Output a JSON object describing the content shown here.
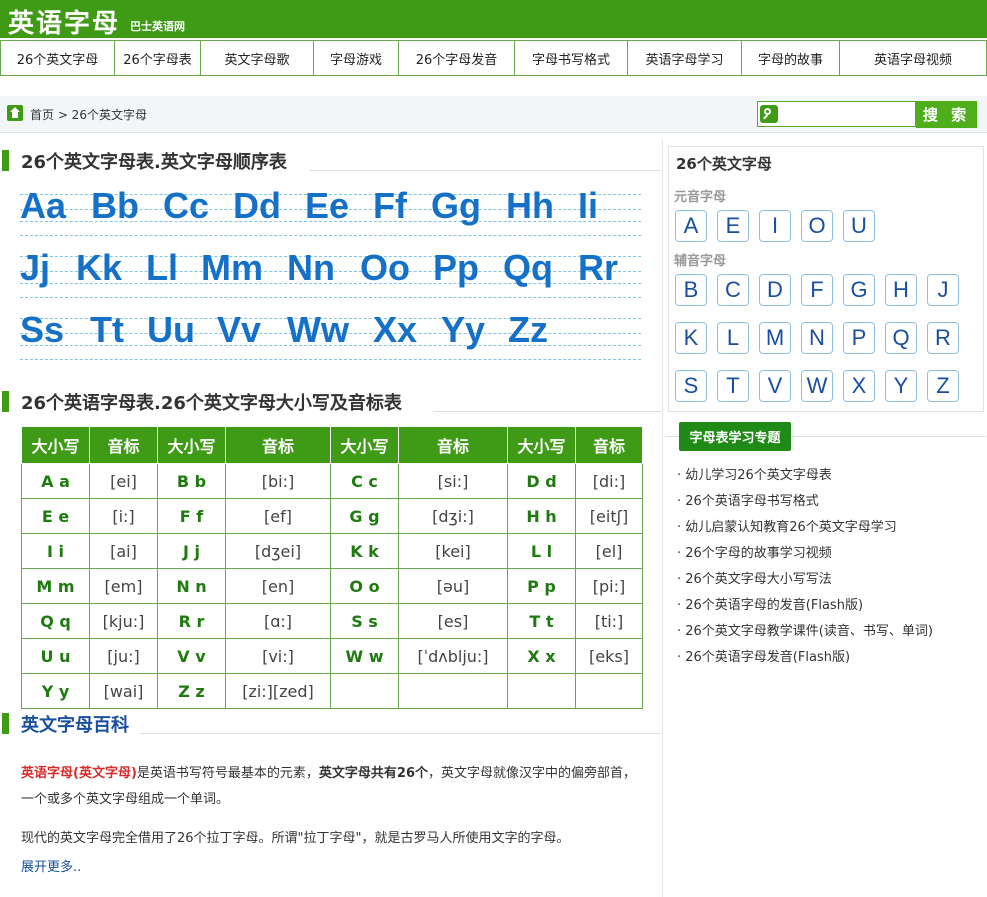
{
  "site": {
    "logo": "英语字母",
    "logo_sub": "巴士英语网"
  },
  "nav": [
    "26个英文字母",
    "26个字母表",
    "英文字母歌",
    "字母游戏",
    "26个字母发音",
    "字母书写格式",
    "英语字母学习",
    "字母的故事",
    "英语字母视频"
  ],
  "breadcrumb": "首页 > 26个英文字母",
  "search": {
    "placeholder": "",
    "button": "搜 索"
  },
  "section1": {
    "title": "26个英文字母表.英文字母顺序表"
  },
  "alphabet_rows": [
    [
      "Aa",
      "Bb",
      "Cc",
      "Dd",
      "Ee",
      "Ff",
      "Gg",
      "Hh",
      "Ii"
    ],
    [
      "Jj",
      "Kk",
      "Ll",
      "Mm",
      "Nn",
      "Oo",
      "Pp",
      "Qq",
      "Rr"
    ],
    [
      "Ss",
      "Tt",
      "Uu",
      "Vv",
      "Ww",
      "Xx",
      "Yy",
      "Zz"
    ]
  ],
  "section2": {
    "title": "26个英语字母表.26个英文字母大小写及音标表"
  },
  "table": {
    "headers": [
      "大小写",
      "音标",
      "大小写",
      "音标",
      "大小写",
      "音标",
      "大小写",
      "音标"
    ],
    "rows": [
      [
        "A a",
        "[ei]",
        "B b",
        "[bi:]",
        "C c",
        "[si:]",
        "D d",
        "[di:]"
      ],
      [
        "E e",
        "[i:]",
        "F f",
        "[ef]",
        "G g",
        "[dʒi:]",
        "H h",
        "[eitʃ]"
      ],
      [
        "I i",
        "[ai]",
        "J j",
        "[dʒei]",
        "K k",
        "[kei]",
        "L l",
        "[el]"
      ],
      [
        "M m",
        "[em]",
        "N n",
        "[en]",
        "O o",
        "[əu]",
        "P p",
        "[pi:]"
      ],
      [
        "Q q",
        "[kju:]",
        "R r",
        "[ɑ:]",
        "S s",
        "[es]",
        "T t",
        "[ti:]"
      ],
      [
        "U u",
        "[ju:]",
        "V v",
        "[vi:]",
        "W w",
        "[ˈdʌblju:]",
        "X x",
        "[eks]"
      ],
      [
        "Y y",
        "[wai]",
        "Z z",
        "[zi:][zed]",
        "",
        "",
        "",
        ""
      ]
    ]
  },
  "section3": {
    "title": "英文字母百科"
  },
  "para1": {
    "red": "英语字母(英文字母)",
    "t1": "是英语书写符号最基本的元素，",
    "bold": "英文字母共有26个",
    "t2": "，英文字母就像汉字中的偏旁部首，一个或多个英文字母组成一个单词。"
  },
  "para2": "现代的英文字母完全借用了26个拉丁字母。所谓\"拉丁字母\"，就是古罗马人所使用文字的字母。",
  "more": "展开更多..",
  "side": {
    "title": "26个英文字母",
    "vowel_label": "元音字母",
    "vowels": [
      "A",
      "E",
      "I",
      "O",
      "U"
    ],
    "consonant_label": "辅音字母",
    "consonants": [
      "B",
      "C",
      "D",
      "F",
      "G",
      "H",
      "J",
      "K",
      "L",
      "M",
      "N",
      "P",
      "Q",
      "R",
      "S",
      "T",
      "V",
      "W",
      "X",
      "Y",
      "Z"
    ],
    "tag": "字母表学习专题",
    "links": [
      "· 幼儿学习26个英文字母表",
      "· 26个英语字母书写格式",
      "· 幼儿启蒙认知教育26个英文字母学习",
      "· 26个字母的故事学习视频",
      "· 26个英文字母大小写写法",
      "· 26个英语字母的发音(Flash版)",
      "· 26个英文字母教学课件(读音、书写、单词)",
      "· 26个英语字母发音(Flash版)"
    ]
  }
}
